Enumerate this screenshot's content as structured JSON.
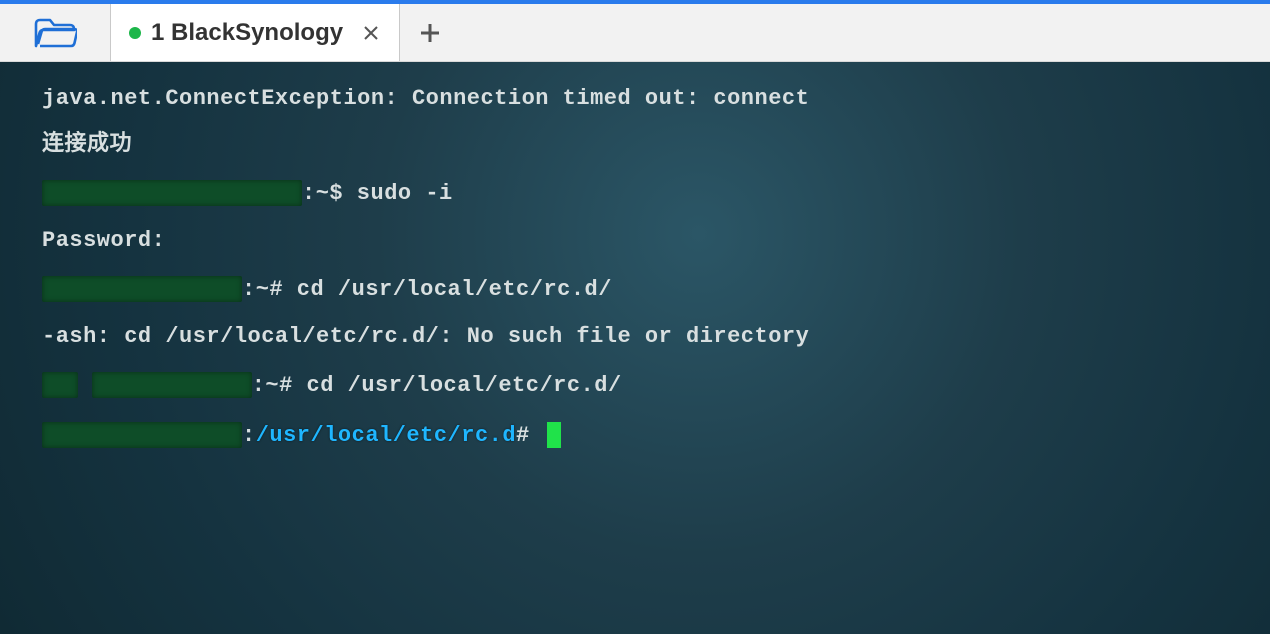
{
  "tabbar": {
    "tab": {
      "index": "1",
      "title": "BlackSynology"
    }
  },
  "terminal": {
    "l1": "java.net.ConnectException: Connection timed out: connect",
    "l2": "连接成功",
    "l3_tail": ":~$ sudo -i",
    "l4": "Password:",
    "l5_tail": ":~# cd /usr/local/etc/rc.d/",
    "l6": "-ash: cd /usr/local/etc/rc.d/: No such file or directory",
    "l7_tail": ":~# cd /usr/local/etc/rc.d/",
    "l8_colon": ":",
    "l8_path": "/usr/local/etc/rc.d",
    "l8_prompt": "# "
  }
}
